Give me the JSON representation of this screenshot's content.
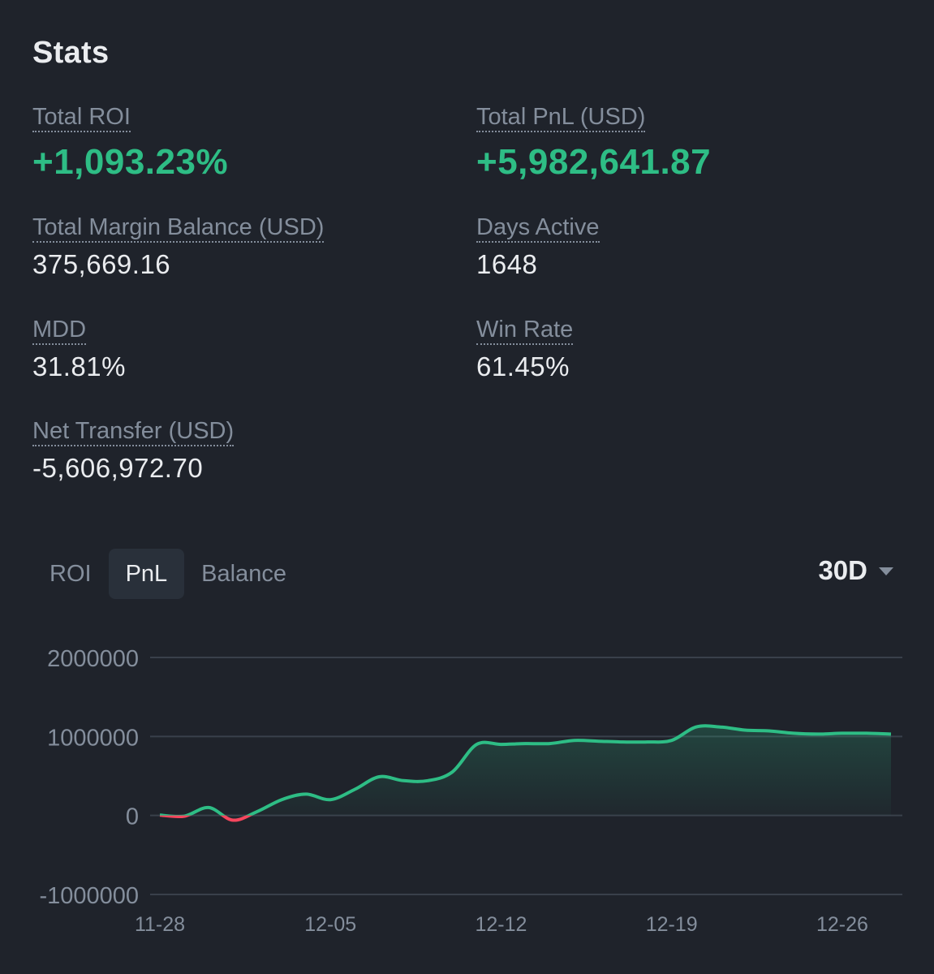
{
  "header": {
    "title": "Stats"
  },
  "stats": {
    "total_roi": {
      "label": "Total ROI",
      "value": "+1,093.23%"
    },
    "total_pnl": {
      "label": "Total PnL (USD)",
      "value": "+5,982,641.87"
    },
    "margin_balance": {
      "label": "Total Margin Balance (USD)",
      "value": "375,669.16"
    },
    "days_active": {
      "label": "Days Active",
      "value": "1648"
    },
    "mdd": {
      "label": "MDD",
      "value": "31.81%"
    },
    "win_rate": {
      "label": "Win Rate",
      "value": "61.45%"
    },
    "net_transfer": {
      "label": "Net Transfer (USD)",
      "value": "-5,606,972.70"
    }
  },
  "tabs": [
    {
      "label": "ROI",
      "active": false
    },
    {
      "label": "PnL",
      "active": true
    },
    {
      "label": "Balance",
      "active": false
    }
  ],
  "range": {
    "label": "30D"
  },
  "colors": {
    "positive": "#2ebd85",
    "negative": "#f6465d",
    "grid": "#39404b",
    "muted": "#848e9c",
    "background": "#1f232b"
  },
  "chart_data": {
    "type": "area",
    "xlabel": "",
    "ylabel": "",
    "ylim": [
      -1000000,
      2000000
    ],
    "y_ticks": [
      2000000,
      1000000,
      0,
      -1000000
    ],
    "y_tick_labels": [
      "2000000",
      "1000000",
      "0",
      "-1000000"
    ],
    "x_ticks": [
      "11-28",
      "12-05",
      "12-12",
      "12-19",
      "12-26"
    ],
    "grid": true,
    "legend": "none",
    "series": [
      {
        "x": [
          "11-28",
          "11-29",
          "11-30",
          "12-01",
          "12-02",
          "12-03",
          "12-04",
          "12-05",
          "12-06",
          "12-07",
          "12-08",
          "12-09",
          "12-10",
          "12-11",
          "12-12",
          "12-13",
          "12-14",
          "12-15",
          "12-16",
          "12-17",
          "12-18",
          "12-19",
          "12-20",
          "12-21",
          "12-22",
          "12-23",
          "12-24",
          "12-25",
          "12-26",
          "12-27",
          "12-28"
        ],
        "values": [
          5000,
          -10000,
          100000,
          -60000,
          50000,
          200000,
          270000,
          200000,
          330000,
          490000,
          440000,
          440000,
          550000,
          900000,
          900000,
          910000,
          910000,
          950000,
          940000,
          930000,
          930000,
          950000,
          1120000,
          1120000,
          1080000,
          1070000,
          1040000,
          1030000,
          1040000,
          1040000,
          1030000
        ]
      }
    ]
  }
}
